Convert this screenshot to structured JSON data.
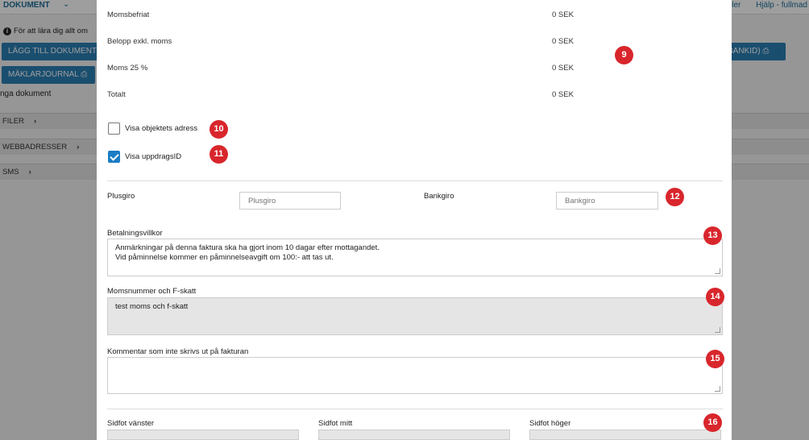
{
  "background": {
    "doc_tab": "DOKUMENT",
    "right_links": [
      "ler",
      "Hjälp - fullmad"
    ],
    "info_text": "För att lära dig allt om",
    "add_doc_button": "LÄGG TILL DOKUMENT",
    "journal_button": "MÄKLARJOURNAL",
    "bankid_button": "BANKID)",
    "no_docs": "nga dokument",
    "rows": {
      "files": "FILER",
      "web": "WEBBADRESSER",
      "sms": "SMS"
    }
  },
  "summary": [
    {
      "label": "Momsbefriat",
      "value": "0 SEK"
    },
    {
      "label": "Belopp exkl. moms",
      "value": "0 SEK"
    },
    {
      "label": "Moms 25 %",
      "value": "0 SEK"
    },
    {
      "label": "Totalt",
      "value": "0 SEK"
    }
  ],
  "checkboxes": {
    "show_address": {
      "label": "Visa objektets adress",
      "checked": false
    },
    "show_assignment_id": {
      "label": "Visa uppdragsID",
      "checked": true
    }
  },
  "payment": {
    "plusgiro_label": "Plusgiro",
    "plusgiro_placeholder": "Plusgiro",
    "bankgiro_label": "Bankgiro",
    "bankgiro_placeholder": "Bankgiro"
  },
  "terms": {
    "label": "Betalningsvillkor",
    "lines": [
      "Anmärkningar på denna faktura ska ha gjort inom 10 dagar efter mottagandet.",
      "Vid påminnelse kommer en påminnelseavgift om 100:- att tas ut."
    ]
  },
  "vat": {
    "label": "Momsnummer och F-skatt",
    "value": "test moms och f-skatt"
  },
  "comment": {
    "label": "Kommentar som inte skrivs ut på fakturan",
    "value": ""
  },
  "footer": {
    "left": "Sidfot vänster",
    "middle": "Sidfot mitt",
    "right": "Sidfot höger"
  },
  "badges": [
    "9",
    "10",
    "11",
    "12",
    "13",
    "14",
    "15",
    "16"
  ],
  "colors": {
    "badge": "#d8262c",
    "primary": "#2b7eb4",
    "checkbox": "#1b7dc4"
  }
}
